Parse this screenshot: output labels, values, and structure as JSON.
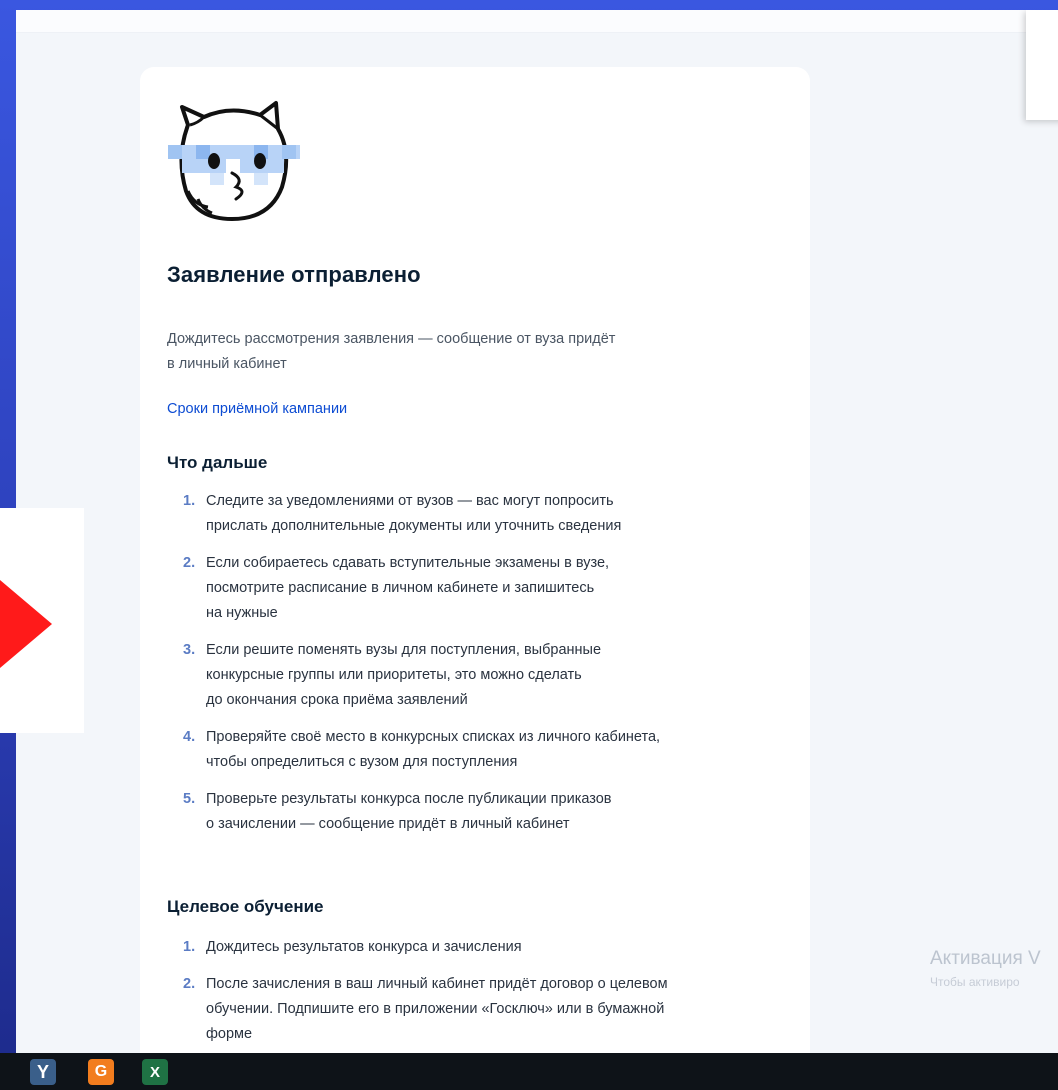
{
  "card": {
    "title": "Заявление отправлено",
    "subtitle_line1": "Дождитесь рассмотрения заявления — сообщение от вуза придёт",
    "subtitle_line2": "в личный кабинет",
    "link": "Сроки приёмной кампании"
  },
  "next_steps": {
    "heading": "Что дальше",
    "items": [
      {
        "n": "1.",
        "lines": [
          "Следите за уведомлениями от вузов — вас могут попросить",
          "прислать дополнительные документы или уточнить сведения"
        ]
      },
      {
        "n": "2.",
        "lines": [
          "Если собираетесь сдавать вступительные экзамены в вузе,",
          "посмотрите расписание в личном кабинете и запишитесь",
          "на нужные"
        ]
      },
      {
        "n": "3.",
        "lines": [
          "Если решите поменять вузы для поступления, выбранные",
          "конкурсные группы или приоритеты, это можно сделать",
          "до окончания срока приёма заявлений"
        ]
      },
      {
        "n": "4.",
        "lines": [
          "Проверяйте своё место в конкурсных списках из личного кабинета,",
          "чтобы определиться с вузом для поступления"
        ]
      },
      {
        "n": "5.",
        "lines": [
          "Проверьте результаты конкурса после публикации приказов",
          "о зачислении — сообщение придёт в личный кабинет"
        ]
      }
    ]
  },
  "targeted": {
    "heading": "Целевое обучение",
    "items": [
      {
        "n": "1.",
        "lines": [
          "Дождитесь результатов конкурса и зачисления"
        ]
      },
      {
        "n": "2.",
        "lines": [
          "После зачисления в ваш личный кабинет придёт договор о целевом",
          "обучении. Подпишите его в приложении «Госключ» или в бумажной",
          "форме"
        ]
      }
    ]
  },
  "watermark": {
    "line1": "Активация V",
    "line2": "Чтобы активиро"
  },
  "taskbar": {
    "icons": [
      "yandex-browser-icon",
      "app-orange-icon",
      "excel-icon"
    ],
    "yandex_letter": "Y",
    "orange_letter": "G",
    "excel_letter": "X"
  },
  "colors": {
    "accent_link": "#0d4cd3",
    "list_number": "#5b7cc4",
    "heading": "#0b1f33",
    "background_frame": "#2c3fb9",
    "arrow": "#ff1a1a"
  }
}
